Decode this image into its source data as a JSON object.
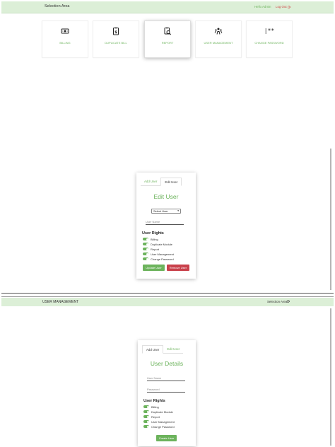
{
  "top": {
    "title": "Selection Area",
    "hello": "Hello Admin",
    "logout": "Log Out"
  },
  "tiles": [
    {
      "label": "BILLING",
      "icon": "money-bill-icon"
    },
    {
      "label": "DUPLICATE BILL",
      "icon": "receipt-dollar-icon"
    },
    {
      "label": "REPORT",
      "icon": "search-document-icon"
    },
    {
      "label": "USER MANAGEMENT",
      "icon": "users-icon"
    },
    {
      "label": "CHANGE PASSWORD",
      "icon": "password-field-icon",
      "glyph": "|**"
    }
  ],
  "edit_card": {
    "tab_add": "Add User",
    "tab_edit": "Edit User",
    "title": "Edit User",
    "select_value": "Select User",
    "user_name_placeholder": "User Name",
    "rights_heading": "User Rights",
    "rights": [
      "Billing",
      "Duplicate Module",
      "Report",
      "User Management",
      "Change Password"
    ],
    "update_label": "Update User",
    "remove_label": "Remove User"
  },
  "section2": {
    "title": "USER MANAGEMENT",
    "selection_area": "Selection Area"
  },
  "add_card": {
    "tab_add": "Add User",
    "tab_edit": "Edit User",
    "title": "User Details",
    "user_name_placeholder": "User Name",
    "password_placeholder": "Password",
    "rights_heading": "User Rights",
    "rights": [
      "Billing",
      "Duplicate Module",
      "Report",
      "User Management",
      "Change Password"
    ],
    "create_label": "Create User"
  },
  "colors": {
    "accent": "#6cb35c",
    "header_bg": "#dcefd7",
    "danger": "#c9414b"
  }
}
